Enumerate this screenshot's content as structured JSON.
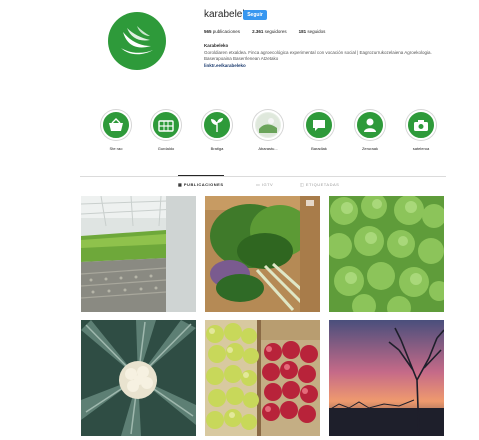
{
  "profile": {
    "username": "karabeleko",
    "follow_label": "Seguir",
    "stats": [
      {
        "count": "565",
        "label": "publicaciones"
      },
      {
        "count": "2.361",
        "label": "seguidores"
      },
      {
        "count": "181",
        "label": "seguidos"
      }
    ],
    "bio_name": "Karabeleko",
    "bio_text": "Goroldiaren etxaldea. Finca agroecológica experimental con vocación social | Eagrozurrukozelaiena Agroekologia. Baserapoaina Baserrlenean Atzetako",
    "bio_link": "linktr.ee/karabeleko"
  },
  "highlights": [
    {
      "label": "Ste rao",
      "icon": "basket-icon"
    },
    {
      "label": "Gurdaldo",
      "icon": "crate-icon"
    },
    {
      "label": "Bratiga",
      "icon": "plant-icon"
    },
    {
      "label": "Abarastu...",
      "icon": "photo-icon"
    },
    {
      "label": "Baradiak",
      "icon": "chat-icon"
    },
    {
      "label": "Zeruraak",
      "icon": "person-icon"
    },
    {
      "label": "sateleroa",
      "icon": "camera-icon"
    }
  ],
  "tabs": [
    {
      "label": "PUBLICACIONES",
      "active": true
    },
    {
      "label": "IGTV",
      "active": false
    },
    {
      "label": "ETIQUETADAS",
      "active": false
    }
  ],
  "posts": [
    {
      "subject": "greenhouse-seedlings"
    },
    {
      "subject": "vegetable-crate"
    },
    {
      "subject": "lettuce-field"
    },
    {
      "subject": "cauliflower"
    },
    {
      "subject": "apples"
    },
    {
      "subject": "sunset-trees"
    }
  ],
  "colors": {
    "brand_green": "#2e9a3a",
    "follow_blue": "#3897f0"
  }
}
